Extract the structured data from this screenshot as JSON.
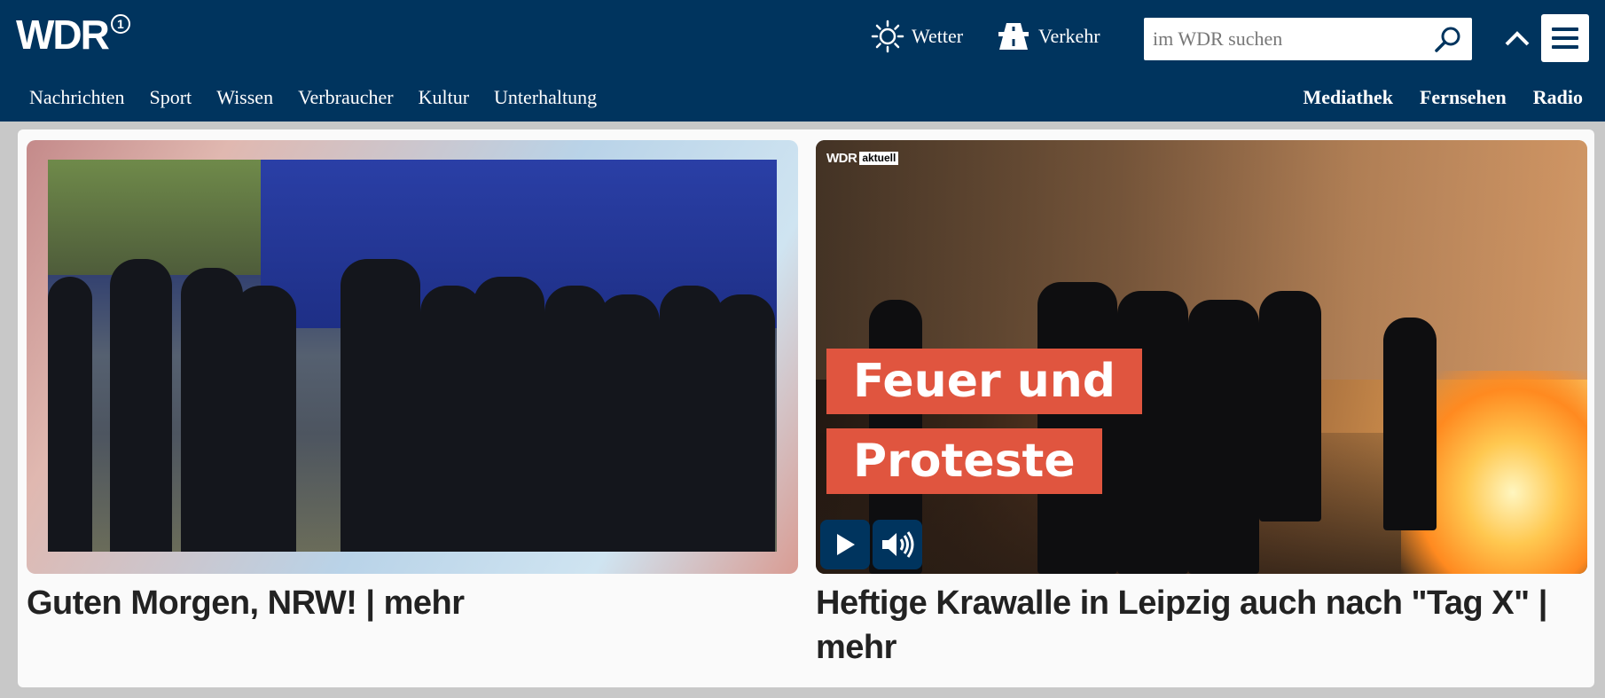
{
  "header": {
    "logo": "WDR",
    "logo_mark": "1",
    "weather_label": "Wetter",
    "traffic_label": "Verkehr",
    "search_placeholder": "im WDR suchen"
  },
  "nav": {
    "items": [
      "Nachrichten",
      "Sport",
      "Wissen",
      "Verbraucher",
      "Kultur",
      "Unterhaltung"
    ],
    "right_items": [
      "Mediathek",
      "Fernsehen",
      "Radio"
    ]
  },
  "teasers": [
    {
      "headline": "Guten Morgen, NRW! | mehr",
      "image": "police-officers-in-riot-gear-photo"
    },
    {
      "headline": "Heftige Krawalle in Leipzig auch nach \"Tag X\" | mehr",
      "image": "street-riot-fire-video",
      "badge_brand": "WDR",
      "badge_label": "aktuell",
      "overlay_line1": "Feuer und",
      "overlay_line2": "Proteste"
    }
  ],
  "colors": {
    "header_bg": "#00345e",
    "overlay_red": "#e0553f",
    "page_bg": "#c8c8c8"
  },
  "icons": [
    "sun-icon",
    "road-icon",
    "search-icon",
    "chevron-up-icon",
    "hamburger-menu-icon",
    "play-icon",
    "speaker-icon"
  ]
}
